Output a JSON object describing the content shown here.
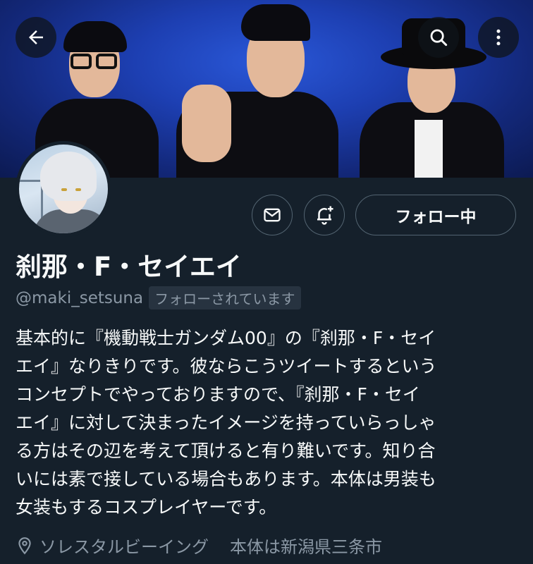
{
  "header": {
    "back_icon": "arrow-left-icon",
    "search_icon": "search-icon",
    "more_icon": "more-vertical-icon"
  },
  "profile": {
    "display_name": "刹那・F・セイエイ",
    "handle": "@maki_setsuna",
    "follows_you": "フォローされています",
    "follow_button": "フォロー中",
    "bio_lines": [
      "基本的に『機動戦士ガンダム00』の『刹那・F・セイ",
      "エイ』なりきりです。彼ならこうツイートするという",
      "コンセプトでやっておりますので、『刹那・F・セイ",
      "エイ』に対して決まったイメージを持っていらっしゃ",
      "る方はその辺を考えて頂けると有り難いです。知り合",
      "いには素で接している場合もあります。本体は男装も",
      "女装もするコスプレイヤーです。"
    ],
    "location": "ソレスタルビーイング",
    "location_extra": "本体は新潟県三条市"
  },
  "colors": {
    "background": "#15202b",
    "text_primary": "#f7f9f9",
    "text_secondary": "#8b98a5",
    "border": "#536471"
  }
}
